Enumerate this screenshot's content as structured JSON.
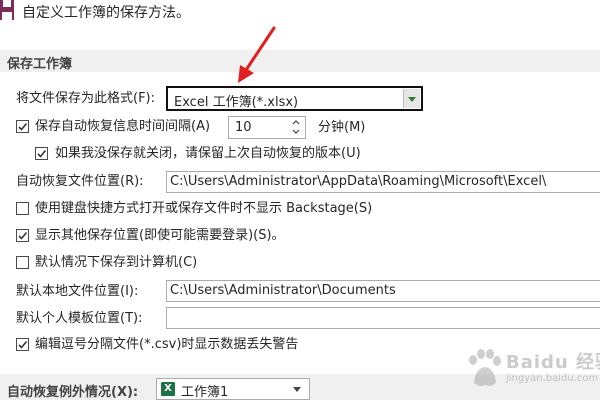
{
  "header": {
    "title": "自定义工作簿的保存方法。",
    "icon": "save-icon"
  },
  "section_save": {
    "title": "保存工作簿"
  },
  "format": {
    "label": "将文件保存为此格式(F):",
    "value": "Excel 工作簿(*.xlsx)"
  },
  "autosave": {
    "checkbox_label": "保存自动恢复信息时间间隔(A)",
    "checked": true,
    "minutes": "10",
    "unit_label": "分钟(M)"
  },
  "keep_last": {
    "label": "如果我没保存就关闭，请保留上次自动恢复的版本(U)",
    "checked": true
  },
  "autorecover_location": {
    "label": "自动恢复文件位置(R):",
    "value": "C:\\Users\\Administrator\\AppData\\Roaming\\Microsoft\\Excel\\"
  },
  "no_backstage": {
    "label": "使用键盘快捷方式打开或保存文件时不显示 Backstage(S)",
    "checked": false
  },
  "show_other": {
    "label": "显示其他保存位置(即使可能需要登录)(S)。",
    "checked": true
  },
  "save_to_computer": {
    "label": "默认情况下保存到计算机(C)",
    "checked": false
  },
  "default_local": {
    "label": "默认本地文件位置(I):",
    "value": "C:\\Users\\Administrator\\Documents"
  },
  "template_location": {
    "label": "默认个人模板位置(T):",
    "value": ""
  },
  "csv_warning": {
    "label": "编辑逗号分隔文件(*.csv)时显示数据丢失警告",
    "checked": true
  },
  "section_exceptions": {
    "title": "自动恢复例外情况(X):",
    "workbook": "工作簿1"
  },
  "watermark": {
    "word": "Baidu 经验",
    "url": "jingyan.baidu.com"
  },
  "colors": {
    "arrow": "#e02020",
    "excel_green": "#1e7145",
    "section_bg": "#f0f0f0"
  }
}
